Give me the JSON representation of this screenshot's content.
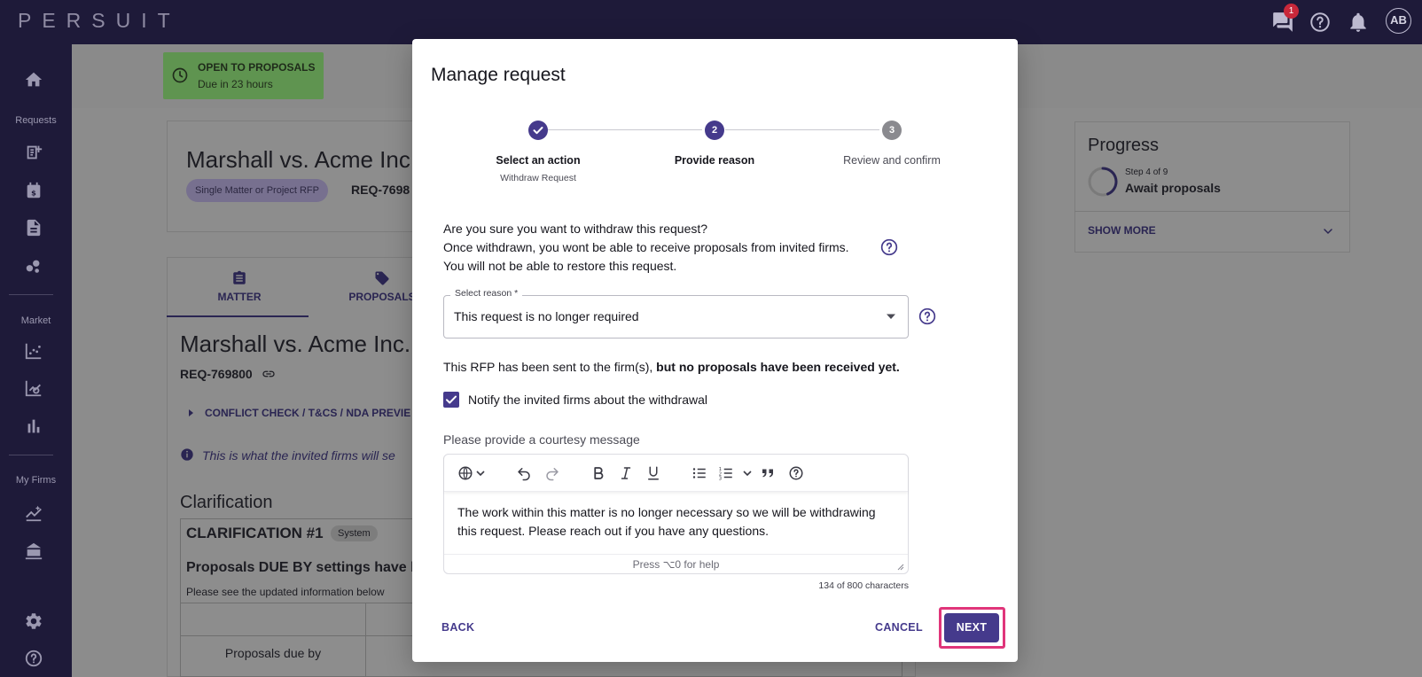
{
  "app": {
    "logo": "PERSUIT",
    "notification_count": "1",
    "avatar_initials": "AB"
  },
  "sidebar": {
    "sections": [
      "Requests",
      "Market",
      "My Firms"
    ]
  },
  "background": {
    "status_title": "OPEN TO PROPOSALS",
    "status_sub": "Due in 23 hours",
    "matter_title": "Marshall vs. Acme Inc.",
    "pill": "Single Matter or Project RFP",
    "req_short": "REQ-7698",
    "tabs": [
      "MATTER",
      "PROPOSALS"
    ],
    "matter_title_2": "Marshall vs. Acme Inc.",
    "req_full": "REQ-769800",
    "conflict_link": "CONFLICT CHECK / T&CS / NDA PREVIE",
    "info_text": "This is what the invited firms will se",
    "clarification_heading": "Clarification",
    "clarification_title": "CLARIFICATION #1",
    "clarification_badge": "System",
    "due_heading": "Proposals DUE BY settings have be",
    "updated_info": "Please see the updated information below",
    "table_cell": "Proposals due by",
    "progress": {
      "title": "Progress",
      "step": "Step 4 of 9",
      "stage": "Await proposals",
      "fraction": 0.44,
      "show_more": "SHOW MORE"
    }
  },
  "modal": {
    "title": "Manage request",
    "steps": [
      {
        "label": "Select an action",
        "sub": "Withdraw Request",
        "state": "done"
      },
      {
        "label": "Provide reason",
        "number": "2",
        "state": "active"
      },
      {
        "label": "Review and confirm",
        "number": "3",
        "state": "todo"
      }
    ],
    "confirm_lines": [
      "Are you sure you want to withdraw this request?",
      "Once withdrawn, you wont be able to receive proposals from invited firms.",
      "You will not be able to restore this request."
    ],
    "select": {
      "label": "Select reason *",
      "value": "This request is no longer required"
    },
    "sent_text": "This RFP has been sent to the firm(s),",
    "sent_text_bold": "but no proposals have been received yet.",
    "notify_label": "Notify the invited firms about the withdrawal",
    "notify_checked": true,
    "courtesy_label": "Please provide a courtesy message",
    "message": "The work within this matter is no longer necessary so we will be withdrawing this request. Please reach out if you have any questions.",
    "editor_help": "Press ⌥0 for help",
    "char_count": "134 of 800 characters",
    "buttons": {
      "back": "BACK",
      "cancel": "CANCEL",
      "next": "NEXT"
    }
  },
  "colors": {
    "brand": "#1e1a39",
    "accent": "#453a8c",
    "highlight": "#e0357a",
    "status_green": "#5f9450"
  }
}
